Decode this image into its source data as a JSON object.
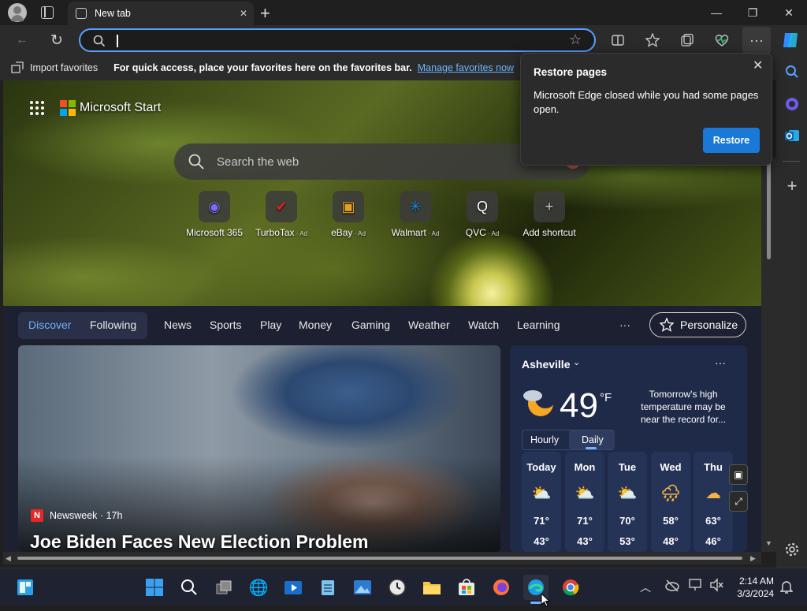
{
  "titlebar": {
    "tab_title": "New tab",
    "new_tab": "+",
    "minimize": "—",
    "restore": "❐",
    "close": "✕",
    "tab_close": "✕"
  },
  "toolbar": {
    "address_value": "",
    "back": "←",
    "refresh": "↻",
    "star": "☆"
  },
  "favorites_bar": {
    "import_label": "Import favorites",
    "hint": "For quick access, place your favorites here on the favorites bar.",
    "manage_link": "Manage favorites now"
  },
  "popup": {
    "title": "Restore pages",
    "message": "Microsoft Edge closed while you had some pages open.",
    "restore_label": "Restore",
    "close": "✕"
  },
  "newtab": {
    "brand": "Microsoft Start",
    "search_placeholder": "Search the web",
    "shortcuts": [
      {
        "label": "Microsoft 365",
        "ad": "",
        "icon": "microsoft365-icon",
        "glyph": "◉",
        "color": "#7b6cf0"
      },
      {
        "label": "TurboTax",
        "ad": "Ad",
        "icon": "turbotax-icon",
        "glyph": "✔",
        "color": "#e02020"
      },
      {
        "label": "eBay",
        "ad": "Ad",
        "icon": "ebay-icon",
        "glyph": "▣",
        "color": "#e5a020"
      },
      {
        "label": "Walmart",
        "ad": "Ad",
        "icon": "walmart-icon",
        "glyph": "✳",
        "color": "#1a8fe0"
      },
      {
        "label": "QVC",
        "ad": "Ad",
        "icon": "qvc-icon",
        "glyph": "Q",
        "color": "#ffffff"
      },
      {
        "label": "Add shortcut",
        "ad": "",
        "icon": "add-icon",
        "glyph": "+",
        "color": "#cfcfcf"
      }
    ],
    "nav": {
      "discover": "Discover",
      "following": "Following",
      "news": "News",
      "sports": "Sports",
      "play": "Play",
      "money": "Money",
      "gaming": "Gaming",
      "weather": "Weather",
      "watch": "Watch",
      "learning": "Learning",
      "more": "···",
      "personalize": "Personalize"
    },
    "story": {
      "source": "Newsweek",
      "age": "17h",
      "separator": "·",
      "headline": "Joe Biden Faces New Election Problem"
    }
  },
  "weather": {
    "city": "Asheville",
    "temp": "49",
    "unit": "°F",
    "note": "Tomorrow's high temperature may be near the record for...",
    "tabs": {
      "hourly": "Hourly",
      "daily": "Daily"
    },
    "more": "···",
    "days": [
      {
        "day": "Today",
        "high": "71°",
        "low": "43°",
        "glyph": "⛅"
      },
      {
        "day": "Mon",
        "high": "71°",
        "low": "43°",
        "glyph": "⛅"
      },
      {
        "day": "Tue",
        "high": "70°",
        "low": "53°",
        "glyph": "⛅"
      },
      {
        "day": "Wed",
        "high": "58°",
        "low": "48°",
        "glyph": "🌧"
      },
      {
        "day": "Thu",
        "high": "63°",
        "low": "46°",
        "glyph": "☁"
      }
    ]
  },
  "taskbar": {
    "time": "2:14 AM",
    "date": "3/3/2024"
  }
}
